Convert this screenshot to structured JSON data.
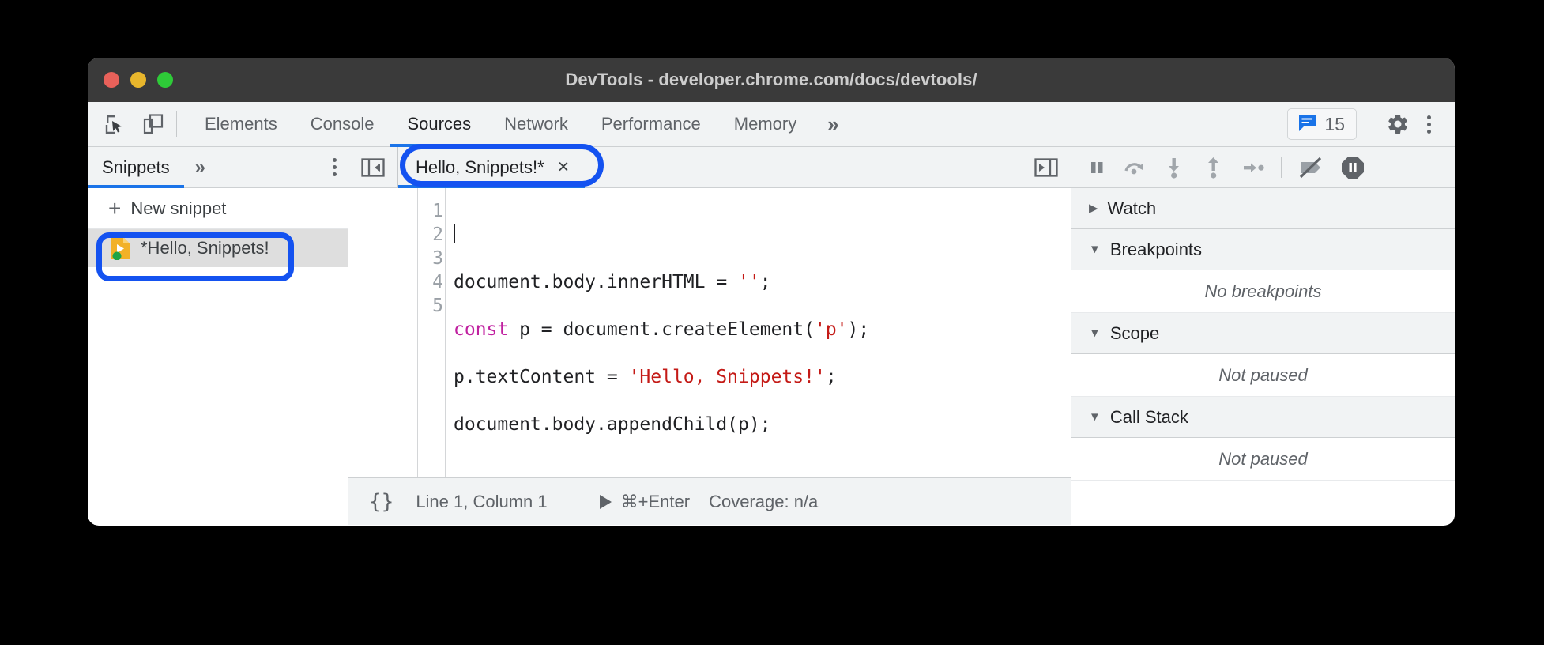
{
  "window": {
    "title": "DevTools - developer.chrome.com/docs/devtools/",
    "traffic_lights": [
      "close",
      "minimize",
      "maximize"
    ]
  },
  "main_toolbar": {
    "inspect_icon": "inspect-cursor-icon",
    "device_icon": "device-toolbar-icon",
    "tabs": [
      {
        "label": "Elements",
        "active": false
      },
      {
        "label": "Console",
        "active": false
      },
      {
        "label": "Sources",
        "active": true
      },
      {
        "label": "Network",
        "active": false
      },
      {
        "label": "Performance",
        "active": false
      },
      {
        "label": "Memory",
        "active": false
      }
    ],
    "more_tabs_label": "»",
    "messages": {
      "icon": "message-badge-icon",
      "count": "15"
    },
    "settings_icon": "gear-icon",
    "more_options_icon": "more-vertical-icon",
    "accent_color": "#1a73e8"
  },
  "navigator": {
    "tab_label": "Snippets",
    "more_tabs_label": "»",
    "more_options_icon": "more-vertical-icon",
    "new_snippet_label": "New snippet",
    "new_snippet_icon": "plus-icon",
    "items": [
      {
        "label": "*Hello, Snippets!",
        "icon": "snippet-file-icon",
        "badge": "green-dot-running-badge",
        "selected": true,
        "highlighted": true
      }
    ]
  },
  "editor": {
    "collapse_icon": "collapse-navigator-icon",
    "open_drawer_icon": "open-quick-source-icon",
    "tab": {
      "label": "Hello, Snippets!*",
      "close_label": "×",
      "highlighted": true
    },
    "lines": [
      "1",
      "2",
      "3",
      "4",
      "5"
    ],
    "code": {
      "line1": "",
      "line2_a": "document.body.innerHTML = ",
      "line2_str": "''",
      "line2_b": ";",
      "line3_kw": "const",
      "line3_a": " p = document.createElement(",
      "line3_str": "'p'",
      "line3_b": ");",
      "line4_a": "p.textContent = ",
      "line4_str": "'Hello, Snippets!'",
      "line4_b": ";",
      "line5": "document.body.appendChild(p);"
    },
    "syntax_colors": {
      "keyword": "#c020a0",
      "string": "#c41a16",
      "text": "#202124"
    },
    "status_bar": {
      "pretty_print_label": "{}",
      "cursor_position": "Line 1, Column 1",
      "run_icon": "play-icon",
      "run_shortcut": "⌘+Enter",
      "coverage": "Coverage: n/a"
    }
  },
  "debugger_toolbar": {
    "buttons": [
      {
        "icon": "pause-icon",
        "name": "pause-script-execution"
      },
      {
        "icon": "step-over-icon",
        "name": "step-over-next-function-call"
      },
      {
        "icon": "step-into-icon",
        "name": "step-into-next-function-call"
      },
      {
        "icon": "step-out-icon",
        "name": "step-out-of-current-function"
      },
      {
        "icon": "step-icon",
        "name": "step"
      },
      {
        "icon": "deactivate-breakpoints-icon",
        "name": "deactivate-breakpoints"
      },
      {
        "icon": "pause-on-exceptions-icon",
        "name": "pause-on-exceptions"
      }
    ]
  },
  "debugger_sidebar": {
    "sections": [
      {
        "title": "Watch",
        "expanded": false,
        "body": null
      },
      {
        "title": "Breakpoints",
        "expanded": true,
        "body": "No breakpoints"
      },
      {
        "title": "Scope",
        "expanded": true,
        "body": "Not paused"
      },
      {
        "title": "Call Stack",
        "expanded": true,
        "body": "Not paused"
      }
    ],
    "expanded_glyph": "▼",
    "collapsed_glyph": "▶"
  },
  "annotations": {
    "highlight_color": "#1452f0",
    "highlight_targets": [
      "navigator-snippet-item",
      "editor-tab"
    ]
  }
}
